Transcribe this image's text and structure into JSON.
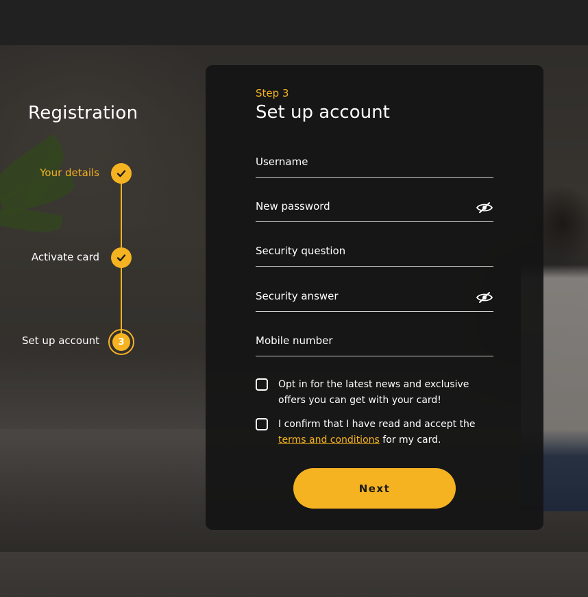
{
  "registration": {
    "title": "Registration",
    "steps": [
      {
        "label": "Your details",
        "status": "complete-active"
      },
      {
        "label": "Activate card",
        "status": "complete"
      },
      {
        "label": "Set up account",
        "status": "current",
        "number": "3"
      }
    ]
  },
  "form": {
    "step_kicker": "Step 3",
    "title": "Set up account",
    "fields": [
      {
        "label": "Username"
      },
      {
        "label": "New password",
        "icon": "eye-slash-icon"
      },
      {
        "label": "Security question"
      },
      {
        "label": "Security answer",
        "icon": "eye-slash-icon"
      },
      {
        "label": "Mobile number"
      }
    ],
    "opt_in": {
      "text": "Opt in for the latest news and exclusive offers you can get with your card!"
    },
    "terms": {
      "prefix": "I confirm that I have read and accept the ",
      "link": "terms and conditions",
      "suffix": " for my card."
    },
    "next_label": "Next"
  },
  "colors": {
    "accent": "#f5b321",
    "card_bg": "#141414",
    "text": "#ffffff"
  }
}
